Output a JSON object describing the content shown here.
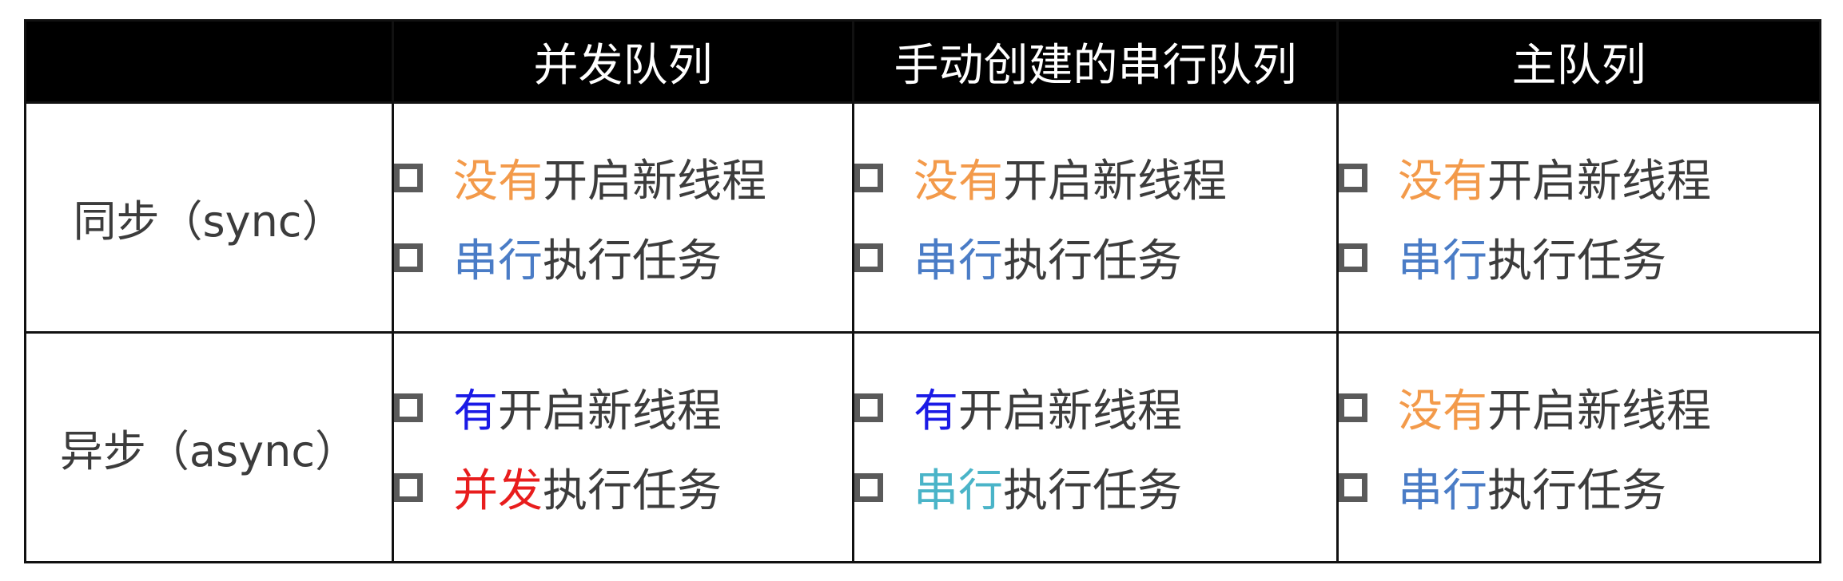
{
  "header": {
    "corner": "",
    "columns": [
      "并发队列",
      "手动创建的串行队列",
      "主队列"
    ]
  },
  "rows": [
    {
      "label": "同步（sync）",
      "cells": [
        [
          {
            "highlight": "没有",
            "color": "#f39a4a",
            "rest": "开启新线程"
          },
          {
            "highlight": "串行",
            "color": "#4a7cc6",
            "rest": "执行任务"
          }
        ],
        [
          {
            "highlight": "没有",
            "color": "#f39a4a",
            "rest": "开启新线程"
          },
          {
            "highlight": "串行",
            "color": "#4a7cc6",
            "rest": "执行任务"
          }
        ],
        [
          {
            "highlight": "没有",
            "color": "#f39a4a",
            "rest": "开启新线程"
          },
          {
            "highlight": "串行",
            "color": "#4a7cc6",
            "rest": "执行任务"
          }
        ]
      ]
    },
    {
      "label": "异步（async）",
      "cells": [
        [
          {
            "highlight": "有",
            "color": "#1a1ae6",
            "rest": "开启新线程"
          },
          {
            "highlight": "并发",
            "color": "#e81d1d",
            "rest": "执行任务"
          }
        ],
        [
          {
            "highlight": "有",
            "color": "#1a1ae6",
            "rest": "开启新线程"
          },
          {
            "highlight": "串行",
            "color": "#4ab4c8",
            "rest": "执行任务"
          }
        ],
        [
          {
            "highlight": "没有",
            "color": "#f39a4a",
            "rest": "开启新线程"
          },
          {
            "highlight": "串行",
            "color": "#4a7cc6",
            "rest": "执行任务"
          }
        ]
      ]
    }
  ]
}
